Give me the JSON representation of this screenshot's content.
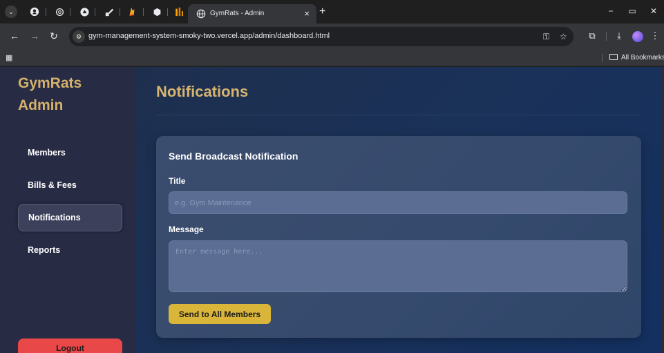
{
  "browser": {
    "tab_title": "GymRats - Admin",
    "tab_close": "×",
    "new_tab": "+",
    "url": "gym-management-system-smoky-two.vercel.app/admin/dashboard.html",
    "bookmarks_all": "All Bookmarks",
    "window": {
      "minimize": "−",
      "restore": "▭",
      "close": "✕"
    }
  },
  "sidebar": {
    "brand_line1": "GymRats",
    "brand_line2": "Admin",
    "items": [
      {
        "label": "Members",
        "active": false
      },
      {
        "label": "Bills & Fees",
        "active": false
      },
      {
        "label": "Notifications",
        "active": true
      },
      {
        "label": "Reports",
        "active": false
      }
    ],
    "logout_label": "Logout"
  },
  "main": {
    "page_title": "Notifications",
    "card": {
      "title": "Send Broadcast Notification",
      "title_label": "Title",
      "title_placeholder": "e.g. Gym Maintenance",
      "title_value": "",
      "message_label": "Message",
      "message_placeholder": "Enter message here...",
      "message_value": "",
      "send_label": "Send to All Members"
    }
  },
  "colors": {
    "accent_gold": "#d6b56f",
    "button_gold": "#d9b53a",
    "logout_red": "#e84848",
    "sidebar_bg": "#272b44",
    "main_bg": "#1a3159"
  }
}
